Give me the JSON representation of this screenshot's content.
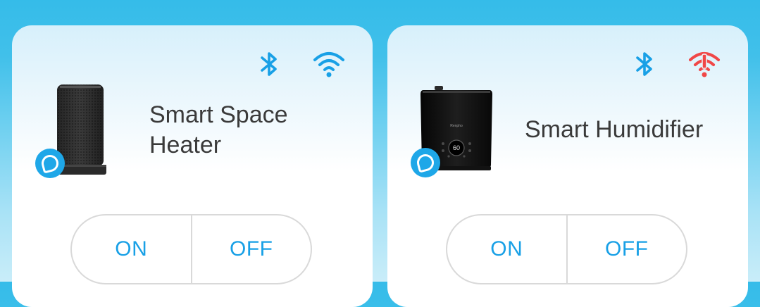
{
  "colors": {
    "accent": "#18a0e6",
    "wifi_error": "#f04747",
    "alexa_blue": "#1ea7e8"
  },
  "devices": [
    {
      "name": "Smart Space Heater",
      "image_icon": "space-heater-image",
      "bluetooth_icon": "bluetooth-icon",
      "wifi_icon": "wifi-icon",
      "wifi_status": "connected",
      "assistant_icon": "alexa-icon",
      "on_label": "ON",
      "off_label": "OFF"
    },
    {
      "name": "Smart Humidifier",
      "image_icon": "humidifier-image",
      "display_value": "60",
      "bluetooth_icon": "bluetooth-icon",
      "wifi_icon": "wifi-alert-icon",
      "wifi_status": "error",
      "assistant_icon": "alexa-icon",
      "on_label": "ON",
      "off_label": "OFF"
    }
  ]
}
